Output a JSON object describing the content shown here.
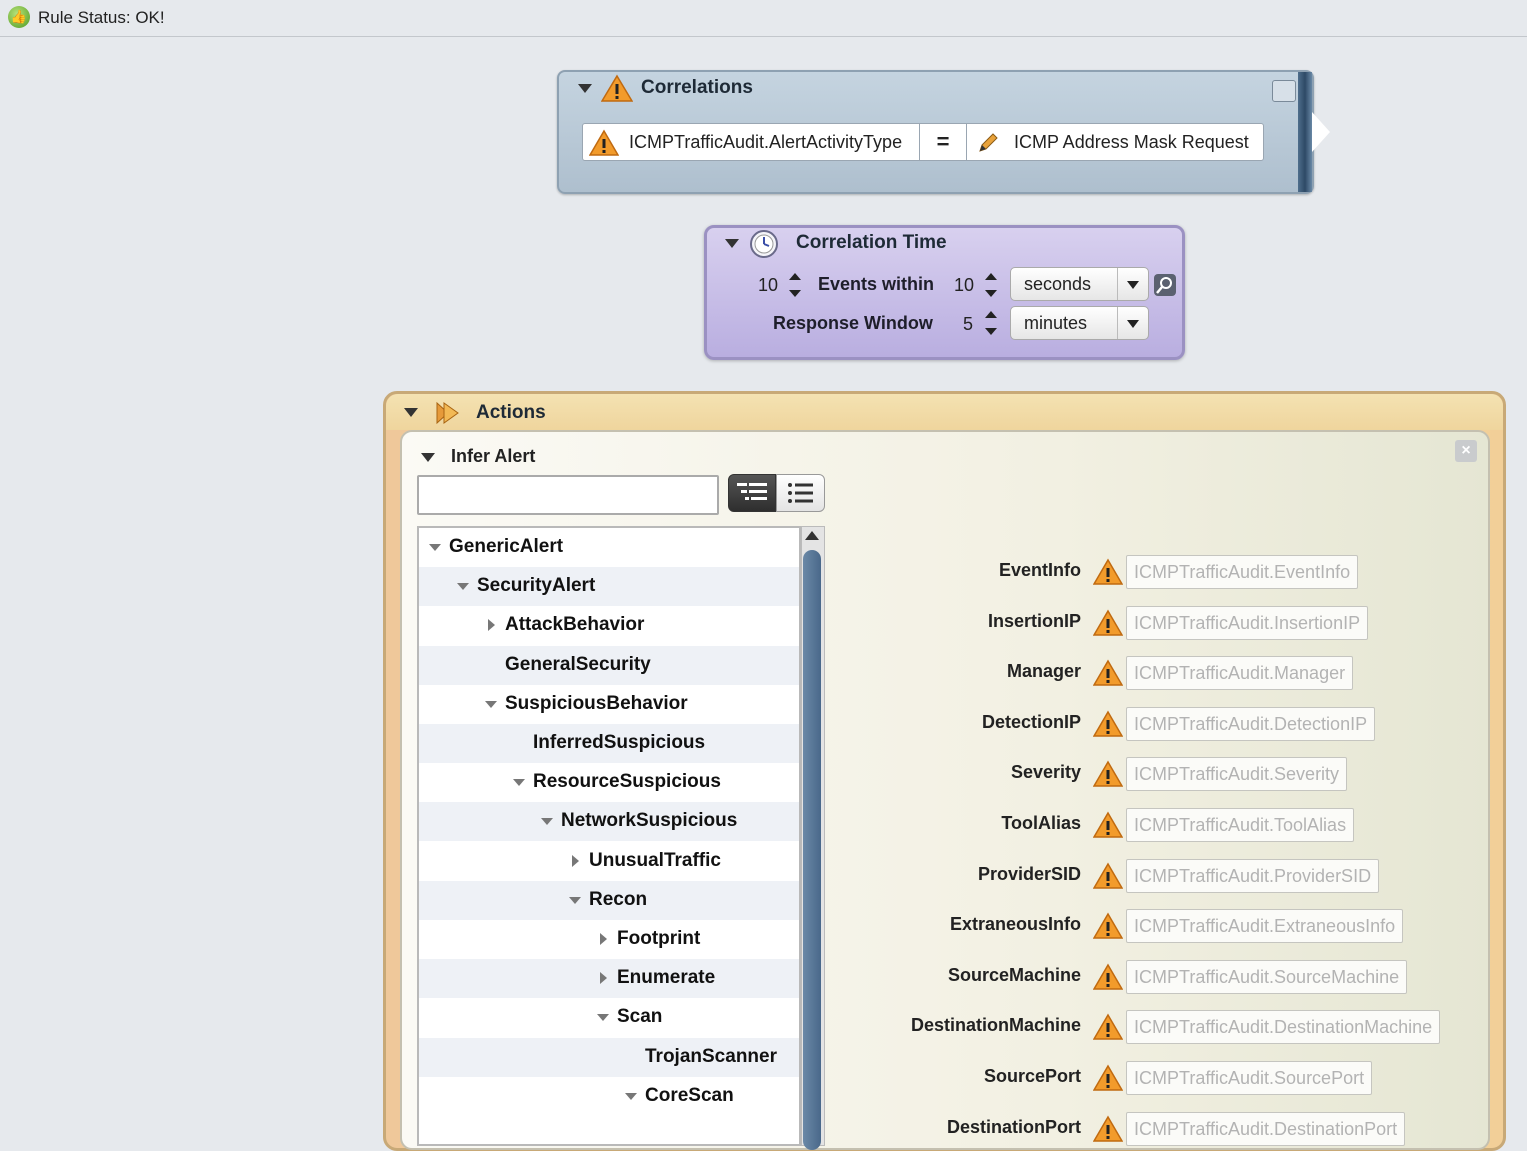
{
  "status": {
    "text": "Rule Status: OK!"
  },
  "correlations": {
    "title": "Correlations",
    "left_operand": "ICMPTrafficAudit.AlertActivityType",
    "operator": "=",
    "right_operand": "ICMP Address Mask Request"
  },
  "correlation_time": {
    "title": "Correlation Time",
    "events_count": "10",
    "events_label": "Events within",
    "within_value": "10",
    "within_unit": "seconds",
    "response_label": "Response Window",
    "response_value": "5",
    "response_unit": "minutes"
  },
  "actions": {
    "title": "Actions",
    "infer_alert": {
      "title": "Infer Alert",
      "search_value": "",
      "tree": [
        {
          "label": "GenericAlert",
          "level": 0,
          "toggle": "expanded"
        },
        {
          "label": "SecurityAlert",
          "level": 1,
          "toggle": "expanded"
        },
        {
          "label": "AttackBehavior",
          "level": 2,
          "toggle": "collapsed"
        },
        {
          "label": "GeneralSecurity",
          "level": 2,
          "toggle": "none"
        },
        {
          "label": "SuspiciousBehavior",
          "level": 2,
          "toggle": "expanded"
        },
        {
          "label": "InferredSuspicious",
          "level": 3,
          "toggle": "none"
        },
        {
          "label": "ResourceSuspicious",
          "level": 3,
          "toggle": "expanded"
        },
        {
          "label": "NetworkSuspicious",
          "level": 4,
          "toggle": "expanded"
        },
        {
          "label": "UnusualTraffic",
          "level": 5,
          "toggle": "collapsed"
        },
        {
          "label": "Recon",
          "level": 5,
          "toggle": "expanded"
        },
        {
          "label": "Footprint",
          "level": 6,
          "toggle": "collapsed"
        },
        {
          "label": "Enumerate",
          "level": 6,
          "toggle": "collapsed"
        },
        {
          "label": "Scan",
          "level": 6,
          "toggle": "expanded"
        },
        {
          "label": "TrojanScanner",
          "level": 7,
          "toggle": "none"
        },
        {
          "label": "CoreScan",
          "level": 7,
          "toggle": "expanded"
        }
      ],
      "fields": [
        {
          "label": "EventInfo",
          "value": "ICMPTrafficAudit.EventInfo"
        },
        {
          "label": "InsertionIP",
          "value": "ICMPTrafficAudit.InsertionIP"
        },
        {
          "label": "Manager",
          "value": "ICMPTrafficAudit.Manager"
        },
        {
          "label": "DetectionIP",
          "value": "ICMPTrafficAudit.DetectionIP"
        },
        {
          "label": "Severity",
          "value": "ICMPTrafficAudit.Severity"
        },
        {
          "label": "ToolAlias",
          "value": "ICMPTrafficAudit.ToolAlias"
        },
        {
          "label": "ProviderSID",
          "value": "ICMPTrafficAudit.ProviderSID"
        },
        {
          "label": "ExtraneousInfo",
          "value": "ICMPTrafficAudit.ExtraneousInfo"
        },
        {
          "label": "SourceMachine",
          "value": "ICMPTrafficAudit.SourceMachine"
        },
        {
          "label": "DestinationMachine",
          "value": "ICMPTrafficAudit.DestinationMachine"
        },
        {
          "label": "SourcePort",
          "value": "ICMPTrafficAudit.SourcePort"
        },
        {
          "label": "DestinationPort",
          "value": "ICMPTrafficAudit.DestinationPort"
        }
      ]
    }
  }
}
